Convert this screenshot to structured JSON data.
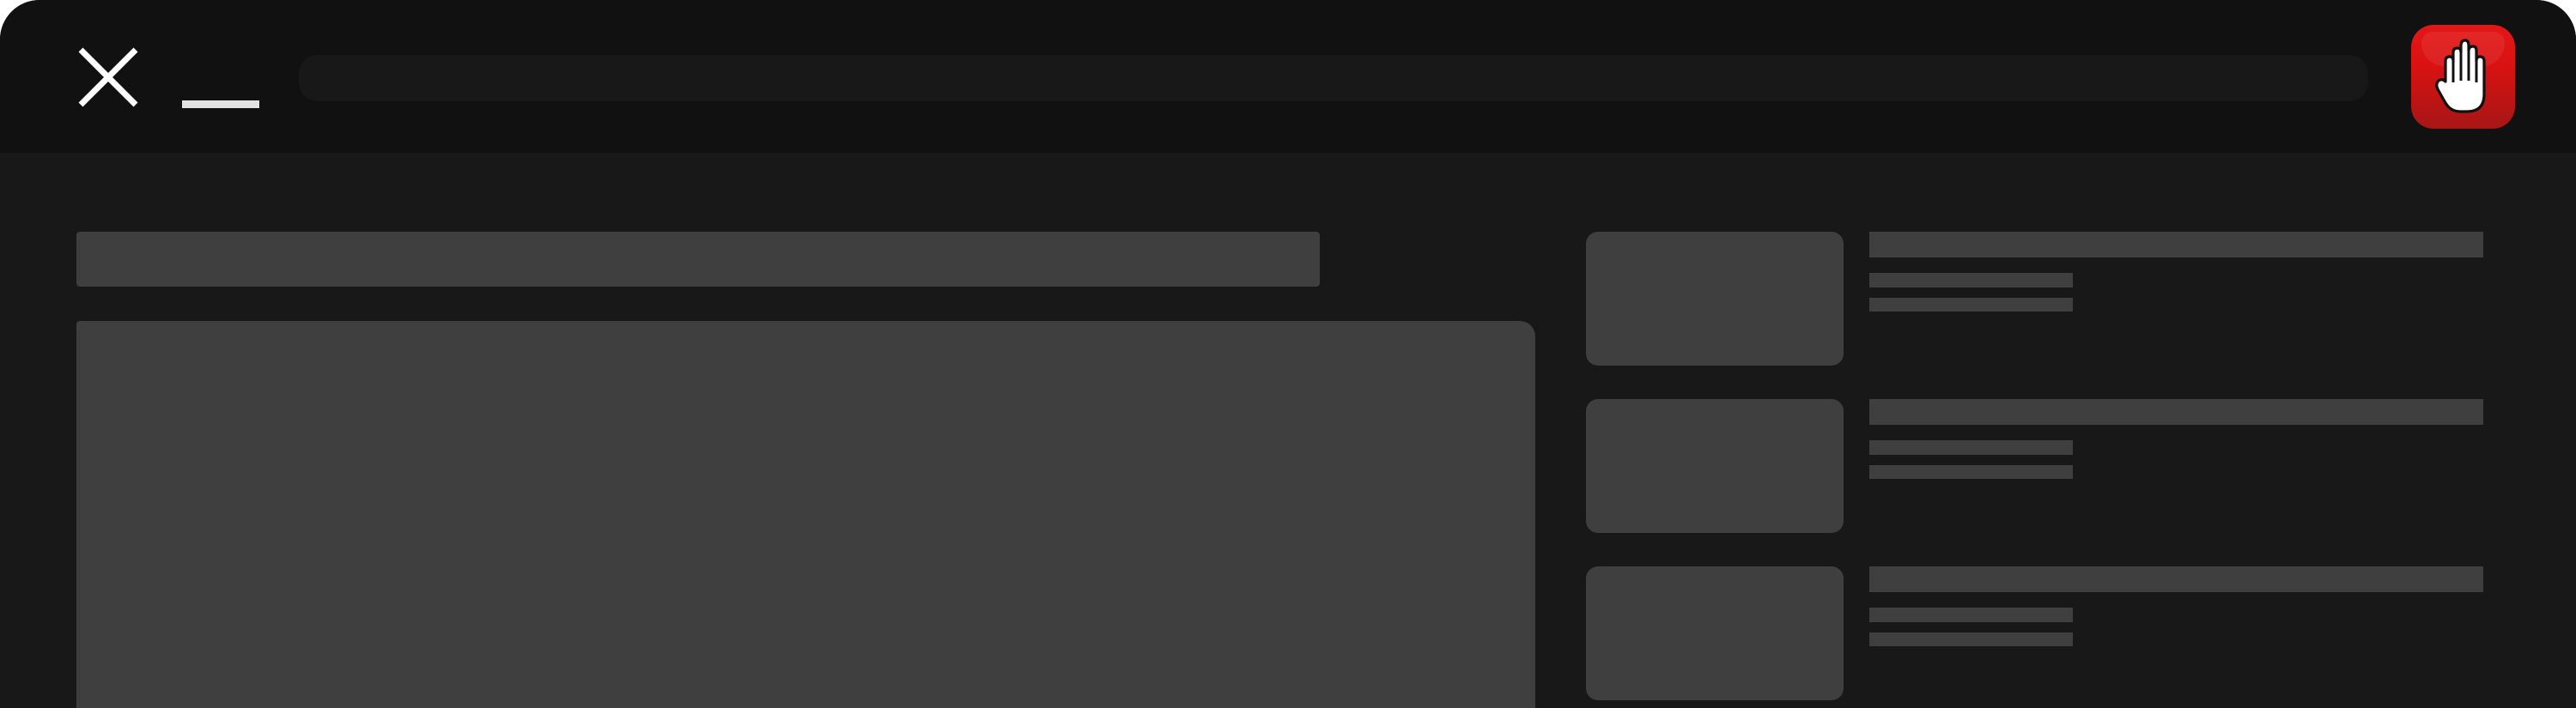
{
  "window": {
    "title": "",
    "controls": {
      "close_icon": "close-icon",
      "minimize_icon": "minimize-icon"
    }
  },
  "address_bar": {
    "value": "",
    "placeholder": ""
  },
  "extension": {
    "icon": "raised-hand-icon",
    "background_color": "#e41717"
  },
  "main": {
    "video_title": "",
    "player": ""
  },
  "related": {
    "items": [
      {
        "title": "",
        "channel": "",
        "meta": ""
      },
      {
        "title": "",
        "channel": "",
        "meta": ""
      },
      {
        "title": "",
        "channel": "",
        "meta": ""
      }
    ]
  },
  "colors": {
    "titlebar_bg": "#111111",
    "content_bg": "#181818",
    "placeholder_bar": "#181818",
    "skeleton": "#3f3f3f",
    "control_icon": "#ffffff"
  }
}
